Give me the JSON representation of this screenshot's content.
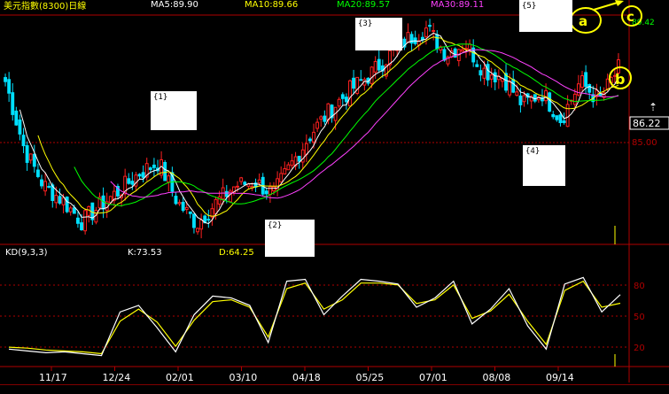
{
  "header": {
    "title": "美元指數(8300)日線",
    "ma5": "MA5:89.90",
    "ma10": "MA10:89.66",
    "ma20": "MA20:89.57",
    "ma30": "MA30:89.11",
    "kd_label": "KD(9,3,3)",
    "k_value": "K:73.53",
    "d_value": "D:64.25"
  },
  "colors": {
    "background": "#000000",
    "up": "#ff2020",
    "down": "#00e0ff",
    "ma5": "#ffffff",
    "ma10": "#ffff00",
    "ma20": "#00ff00",
    "ma30": "#ff40ff",
    "grid": "#b00000",
    "k_line": "#ffffff",
    "d_line": "#ffff00"
  },
  "annotations": {
    "box1": "{1}",
    "box2": "{2}",
    "box3": "{3}",
    "box4": "{4}",
    "box5": "{5}",
    "circle_a": "a",
    "circle_b": "b",
    "circle_c": "c"
  },
  "price_axis": {
    "label_current": "86.22",
    "label_top": "89.42",
    "label_85": "85.00"
  },
  "kd_axis": {
    "label_80": "80",
    "label_50": "50",
    "label_20": "20"
  },
  "chart_data": {
    "type": "line",
    "xlabel": "",
    "ylabel": "",
    "dates": [
      "11/17",
      "12/24",
      "02/01",
      "03/10",
      "04/18",
      "05/25",
      "07/01",
      "08/08",
      "09/14"
    ],
    "price": [
      90.0,
      86.8,
      85.1,
      84.4,
      83.4,
      84.2,
      84.9,
      85.7,
      86.2,
      84.3,
      83.3,
      84.3,
      85.1,
      85.3,
      84.7,
      86.2,
      87.6,
      88.7,
      89.6,
      90.3,
      91.2,
      92.0,
      92.5,
      91.3,
      91.8,
      90.5,
      90.2,
      88.9,
      89.5,
      88.2,
      90.0,
      89.1,
      90.6
    ],
    "price_ylim": [
      82.5,
      93.0
    ],
    "k_values": [
      15,
      13,
      11,
      12,
      10,
      8,
      55,
      62,
      38,
      12,
      52,
      72,
      70,
      62,
      22,
      88,
      90,
      52,
      72,
      90,
      88,
      85,
      60,
      70,
      88,
      42,
      58,
      80,
      40,
      15,
      85,
      92,
      55,
      73.53
    ],
    "d_values": [
      17,
      16,
      14,
      13,
      12,
      10,
      45,
      58,
      44,
      18,
      46,
      66,
      68,
      60,
      28,
      80,
      86,
      58,
      68,
      86,
      86,
      84,
      64,
      68,
      84,
      48,
      56,
      74,
      45,
      20,
      78,
      88,
      60,
      64.25
    ],
    "kd_ylim": [
      0,
      100
    ],
    "kd_gridlines": [
      20,
      50,
      80
    ]
  }
}
